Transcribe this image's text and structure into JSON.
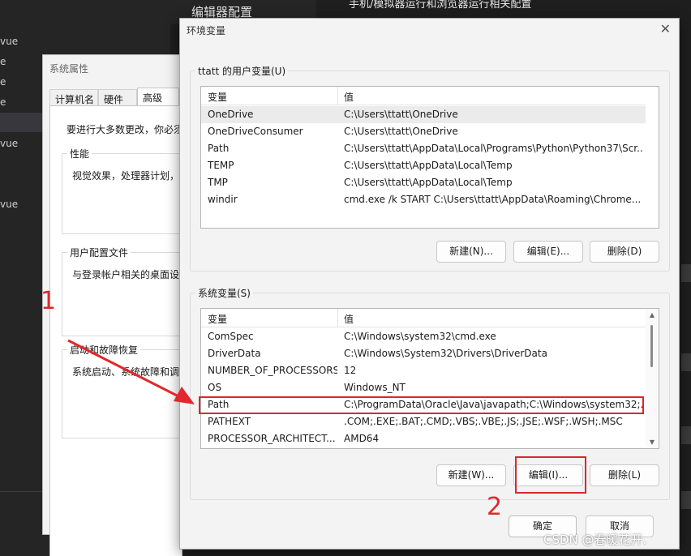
{
  "background": {
    "editor_section_title": "编辑器配置",
    "header_text": "手机/模拟器运行和浏览器运行相关配置",
    "file_items": [
      "vue",
      "e",
      "e",
      "e",
      "vue",
      "vue"
    ]
  },
  "system_properties": {
    "title": "系统属性",
    "tabs": [
      "计算机名",
      "硬件",
      "高级"
    ],
    "intro": "要进行大多数更改，你必须",
    "groups": [
      {
        "label": "性能",
        "text": "视觉效果，处理器计划，"
      },
      {
        "label": "用户配置文件",
        "text": "与登录帐户相关的桌面设"
      },
      {
        "label": "启动和故障恢复",
        "text": "系统启动、系统故障和调"
      }
    ]
  },
  "env_dialog": {
    "title": "环境变量",
    "close_glyph": "✕",
    "user_group_label": "ttatt 的用户变量(U)",
    "system_group_label": "系统变量(S)",
    "col_variable": "变量",
    "col_value": "值",
    "user_vars": [
      {
        "name": "OneDrive",
        "value": "C:\\Users\\ttatt\\OneDrive"
      },
      {
        "name": "OneDriveConsumer",
        "value": "C:\\Users\\ttatt\\OneDrive"
      },
      {
        "name": "Path",
        "value": "C:\\Users\\ttatt\\AppData\\Local\\Programs\\Python\\Python37\\Scr..."
      },
      {
        "name": "TEMP",
        "value": "C:\\Users\\ttatt\\AppData\\Local\\Temp"
      },
      {
        "name": "TMP",
        "value": "C:\\Users\\ttatt\\AppData\\Local\\Temp"
      },
      {
        "name": "windir",
        "value": "cmd.exe /k START C:\\Users\\ttatt\\AppData\\Roaming\\Chrome..."
      }
    ],
    "system_vars": [
      {
        "name": "ComSpec",
        "value": "C:\\Windows\\system32\\cmd.exe"
      },
      {
        "name": "DriverData",
        "value": "C:\\Windows\\System32\\Drivers\\DriverData"
      },
      {
        "name": "NUMBER_OF_PROCESSORS",
        "value": "12"
      },
      {
        "name": "OS",
        "value": "Windows_NT"
      },
      {
        "name": "Path",
        "value": "C:\\ProgramData\\Oracle\\Java\\javapath;C:\\Windows\\system32;..."
      },
      {
        "name": "PATHEXT",
        "value": ".COM;.EXE;.BAT;.CMD;.VBS;.VBE;.JS;.JSE;.WSF;.WSH;.MSC"
      },
      {
        "name": "PROCESSOR_ARCHITECT...",
        "value": "AMD64"
      }
    ],
    "user_buttons": {
      "new": "新建(N)...",
      "edit": "编辑(E)...",
      "delete": "删除(D)"
    },
    "system_buttons": {
      "new": "新建(W)...",
      "edit": "编辑(I)...",
      "delete": "删除(L)"
    },
    "ok": "确定",
    "cancel": "取消"
  },
  "annotations": {
    "step1": "1",
    "step2": "2",
    "color": "#d9272e"
  },
  "watermark": "CSDN @春暖花开."
}
